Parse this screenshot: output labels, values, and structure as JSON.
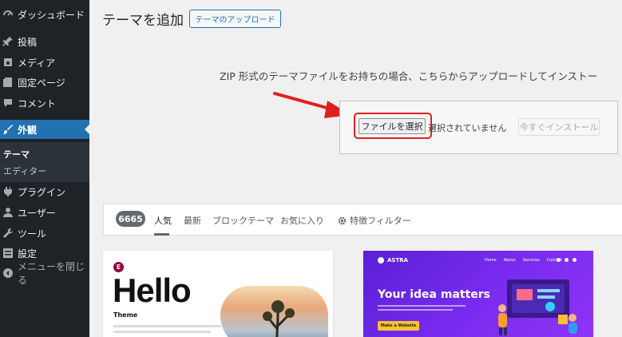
{
  "sidebar": {
    "items": [
      {
        "label": "ダッシュボード",
        "icon": "dashboard-icon"
      },
      {
        "label": "投稿",
        "icon": "pin-icon"
      },
      {
        "label": "メディア",
        "icon": "media-icon"
      },
      {
        "label": "固定ページ",
        "icon": "page-icon"
      },
      {
        "label": "コメント",
        "icon": "comment-icon"
      },
      {
        "label": "外観",
        "icon": "brush-icon"
      },
      {
        "label": "プラグイン",
        "icon": "plugin-icon"
      },
      {
        "label": "ユーザー",
        "icon": "user-icon"
      },
      {
        "label": "ツール",
        "icon": "wrench-icon"
      },
      {
        "label": "設定",
        "icon": "settings-icon"
      },
      {
        "label": "メニューを閉じる",
        "icon": "collapse-icon"
      }
    ],
    "submenu": [
      {
        "label": "テーマ"
      },
      {
        "label": "エディター"
      }
    ]
  },
  "header": {
    "title": "テーマを追加",
    "upload_button": "テーマのアップロード"
  },
  "upload": {
    "help_text": "ZIP 形式のテーマファイルをお持ちの場合、こちらからアップロードしてインストー",
    "choose_file_button": "ファイルを選択",
    "no_file_text": "選択されていません",
    "install_button": "今すぐインストール"
  },
  "filter_bar": {
    "count": "6665",
    "tabs": [
      "人気",
      "最新",
      "ブロックテーマ",
      "お気に入り"
    ],
    "feature_filter": "特徴フィルター"
  },
  "themes": [
    {
      "logo_letter": "E",
      "big_title": "Hello",
      "subtitle": "Theme"
    },
    {
      "brand": "ASTRA",
      "nav": [
        "Home",
        "About",
        "Services",
        "Contact"
      ],
      "headline": "Your idea matters",
      "button": "Make a Website"
    }
  ],
  "colors": {
    "sidebar_bg": "#1d2327",
    "accent": "#2271b1",
    "highlight": "#e02020",
    "astra_purple": "#6f2ce6"
  }
}
